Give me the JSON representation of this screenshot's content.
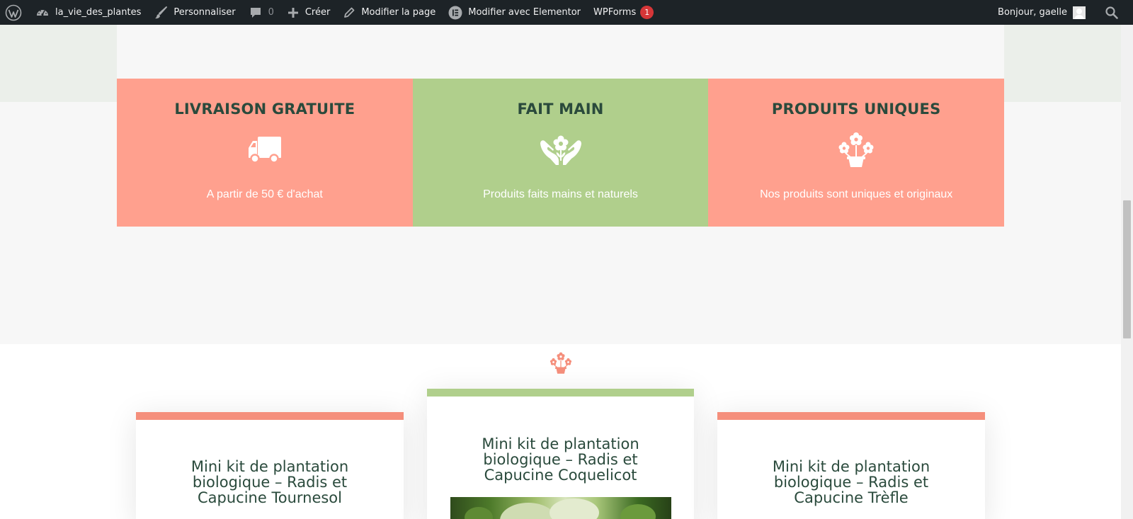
{
  "adminbar": {
    "site_name": "la_vie_des_plantes",
    "customize": "Personnaliser",
    "comments_count": "0",
    "new": "Créer",
    "edit_page": "Modifier la page",
    "elementor": "Modifier avec Elementor",
    "wpforms": "WPForms",
    "wpforms_badge": "1",
    "greeting": "Bonjour, gaelle",
    "icons": [
      "wordpress-logo-icon",
      "dashboard-icon",
      "brush-icon",
      "comment-icon",
      "plus-icon",
      "pencil-icon",
      "elementor-icon",
      "avatar-icon",
      "search-icon"
    ]
  },
  "features": [
    {
      "title": "LIVRAISON GRATUITE",
      "icon": "truck-icon",
      "text": "A partir de 50 € d'achat",
      "color": "#ffa08e"
    },
    {
      "title": "FAIT MAIN",
      "icon": "hands-flower-icon",
      "text": "Produits faits mains et naturels",
      "color": "#b0cf8c"
    },
    {
      "title": "PRODUITS UNIQUES",
      "icon": "flower-pot-icon",
      "text": "Nos produits sont uniques et originaux",
      "color": "#ffa08e"
    }
  ],
  "separator_icon": "flower-pot-icon",
  "products": [
    {
      "title": "Mini kit de plantation biologique – Radis et Capucine Tournesol",
      "accent": "#f58f7c"
    },
    {
      "title": "Mini kit de plantation biologique – Radis et Capucine Coquelicot",
      "accent": "#b0cf8c"
    },
    {
      "title": "Mini kit de plantation biologique – Radis et Capucine Trèfle",
      "accent": "#f58f7c"
    }
  ],
  "colors": {
    "adminbar": "#1d2327",
    "heading": "#2a4a3c",
    "salmon": "#ffa08e",
    "green": "#b0cf8c"
  }
}
